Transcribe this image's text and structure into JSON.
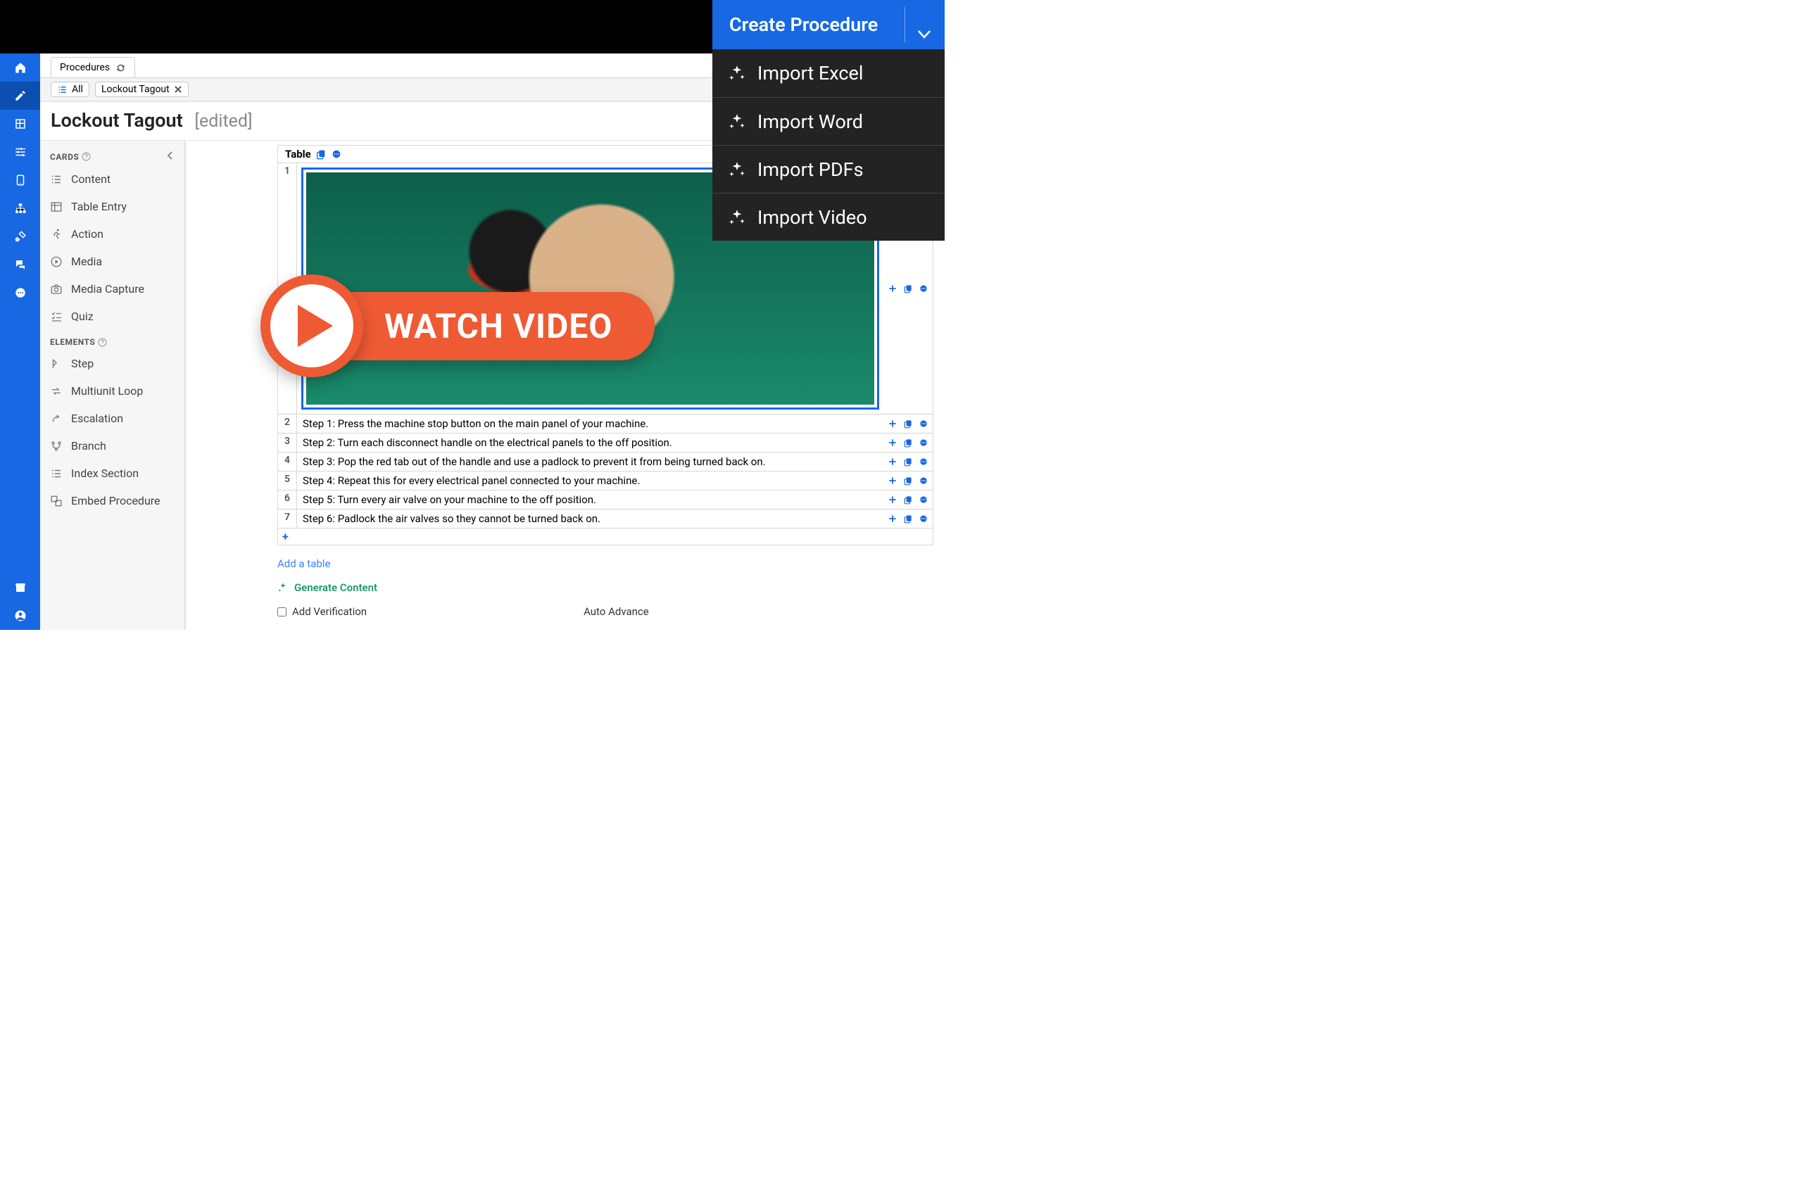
{
  "topbar": {
    "tab_label": "Procedures"
  },
  "pills": {
    "all": "All",
    "current": "Lockout Tagout"
  },
  "title": {
    "name": "Lockout Tagout",
    "edited": "[edited]"
  },
  "create_menu": {
    "header": "Create Procedure",
    "items": [
      "Import Excel",
      "Import Word",
      "Import PDFs",
      "Import Video"
    ]
  },
  "sidebar": {
    "cards_header": "CARDS",
    "cards": [
      "Content",
      "Table Entry",
      "Action",
      "Media",
      "Media Capture",
      "Quiz"
    ],
    "elements_header": "ELEMENTS",
    "elements": [
      "Step",
      "Multiunit Loop",
      "Escalation",
      "Branch",
      "Index Section",
      "Embed Procedure"
    ]
  },
  "table": {
    "header": "Table",
    "rows": [
      {
        "n": "1",
        "text": "",
        "image": true
      },
      {
        "n": "2",
        "text": "Step 1: Press the machine stop button on the main panel of your machine."
      },
      {
        "n": "3",
        "text": "Step 2: Turn each disconnect handle on the electrical panels to the off position."
      },
      {
        "n": "4",
        "text": "Step 3: Pop the red tab out of the handle and use a padlock to prevent it from being turned back on."
      },
      {
        "n": "5",
        "text": "Step 4: Repeat this for every electrical panel connected to your machine."
      },
      {
        "n": "6",
        "text": "Step 5: Turn every air valve on your machine to the off position."
      },
      {
        "n": "7",
        "text": "Step 6: Padlock the air valves so they cannot be turned back on."
      }
    ]
  },
  "below": {
    "add_table": "Add a table",
    "generate": "Generate Content",
    "verify": "Add Verification",
    "auto": "Auto Advance"
  },
  "watch": "WATCH VIDEO"
}
